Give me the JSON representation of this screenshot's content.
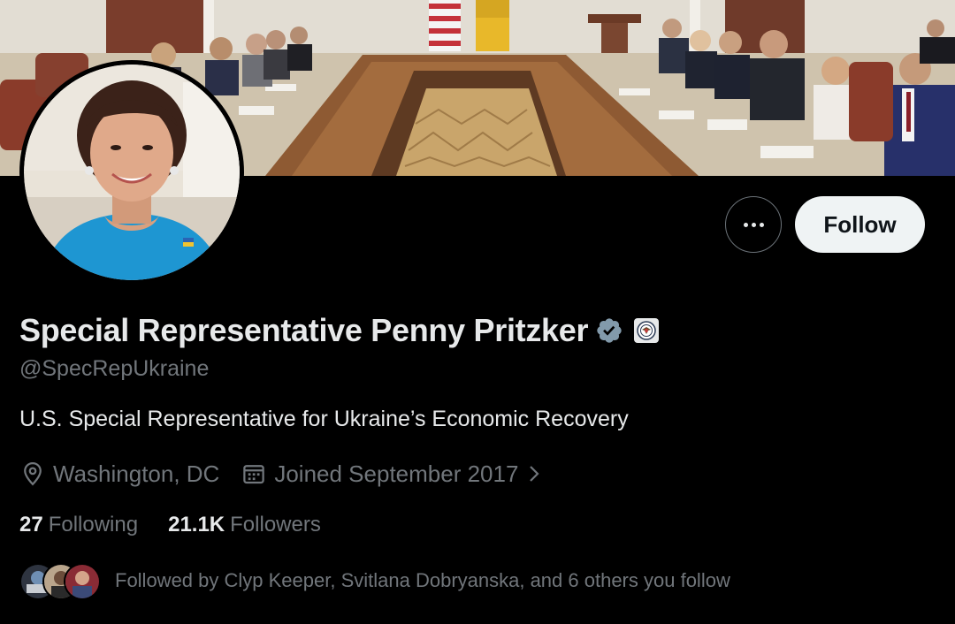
{
  "profile": {
    "display_name": "Special Representative Penny Pritzker",
    "handle": "@SpecRepUkraine",
    "bio": "U.S. Special Representative for Ukraine’s Economic Recovery",
    "location": "Washington, DC",
    "joined": "Joined September 2017",
    "verified_badge_icon": "verified-badge-icon",
    "affiliation_badge_icon": "government-seal-icon"
  },
  "actions": {
    "more_icon": "more-options-icon",
    "follow_label": "Follow"
  },
  "stats": {
    "following_count": "27",
    "following_label": "Following",
    "followers_count": "21.1K",
    "followers_label": "Followers"
  },
  "followed_by": {
    "text": "Followed by Clyp Keeper, Svitlana Dobryanska, and 6 others you follow"
  },
  "colors": {
    "background": "#000000",
    "primary_text": "#e7e9ea",
    "secondary_text": "#71767b",
    "follow_button_bg": "#eff3f4",
    "verified_badge": "#829aab"
  }
}
